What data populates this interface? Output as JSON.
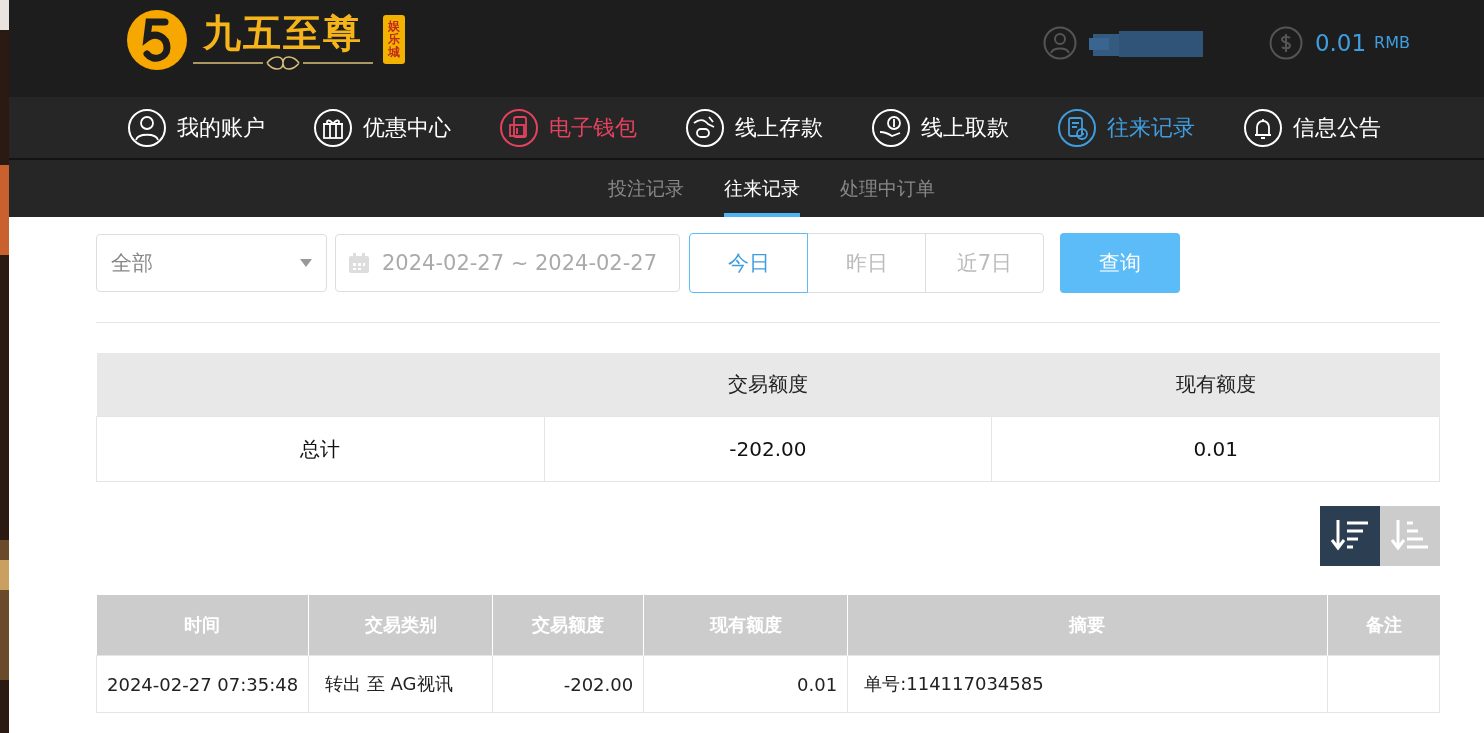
{
  "header": {
    "logo": {
      "title": "九五至尊",
      "badge": "娱乐城"
    },
    "balance": {
      "amount": "0.01",
      "currency": "RMB"
    }
  },
  "nav": [
    {
      "label": "我的账户",
      "kind": "user",
      "color": "#ffffff"
    },
    {
      "label": "优惠中心",
      "kind": "gift",
      "color": "#ffffff"
    },
    {
      "label": "电子钱包",
      "kind": "wallet",
      "color": "#e5425e"
    },
    {
      "label": "线上存款",
      "kind": "deposit",
      "color": "#ffffff"
    },
    {
      "label": "线上取款",
      "kind": "withdraw",
      "color": "#ffffff"
    },
    {
      "label": "往来记录",
      "kind": "records",
      "color": "#3f9ee0"
    },
    {
      "label": "信息公告",
      "kind": "bell",
      "color": "#ffffff"
    }
  ],
  "subtabs": [
    {
      "label": "投注记录",
      "selected": false
    },
    {
      "label": "往来记录",
      "selected": true
    },
    {
      "label": "处理中订单",
      "selected": false
    }
  ],
  "filters": {
    "type_select": {
      "value": "全部"
    },
    "date_range": {
      "value": "2024-02-27 ~ 2024-02-27"
    },
    "quick_ranges": [
      {
        "label": "今日",
        "selected": true
      },
      {
        "label": "昨日",
        "selected": false
      },
      {
        "label": "近7日",
        "selected": false
      }
    ],
    "query_button": "查询"
  },
  "summary": {
    "columns": [
      "交易额度",
      "现有额度"
    ],
    "rows": [
      {
        "label": "总计",
        "cells": [
          "-202.00",
          "0.01"
        ]
      }
    ]
  },
  "sort_buttons": [
    {
      "kind": "desc",
      "selected": true
    },
    {
      "kind": "asc",
      "selected": false
    }
  ],
  "records": {
    "columns": [
      "时间",
      "交易类别",
      "交易额度",
      "现有额度",
      "摘要",
      "备注"
    ],
    "rows": [
      {
        "cells": [
          "2024-02-27 07:35:48",
          "转出 至 AG视讯",
          "-202.00",
          "0.01",
          "单号:114117034585"
        ]
      }
    ]
  }
}
